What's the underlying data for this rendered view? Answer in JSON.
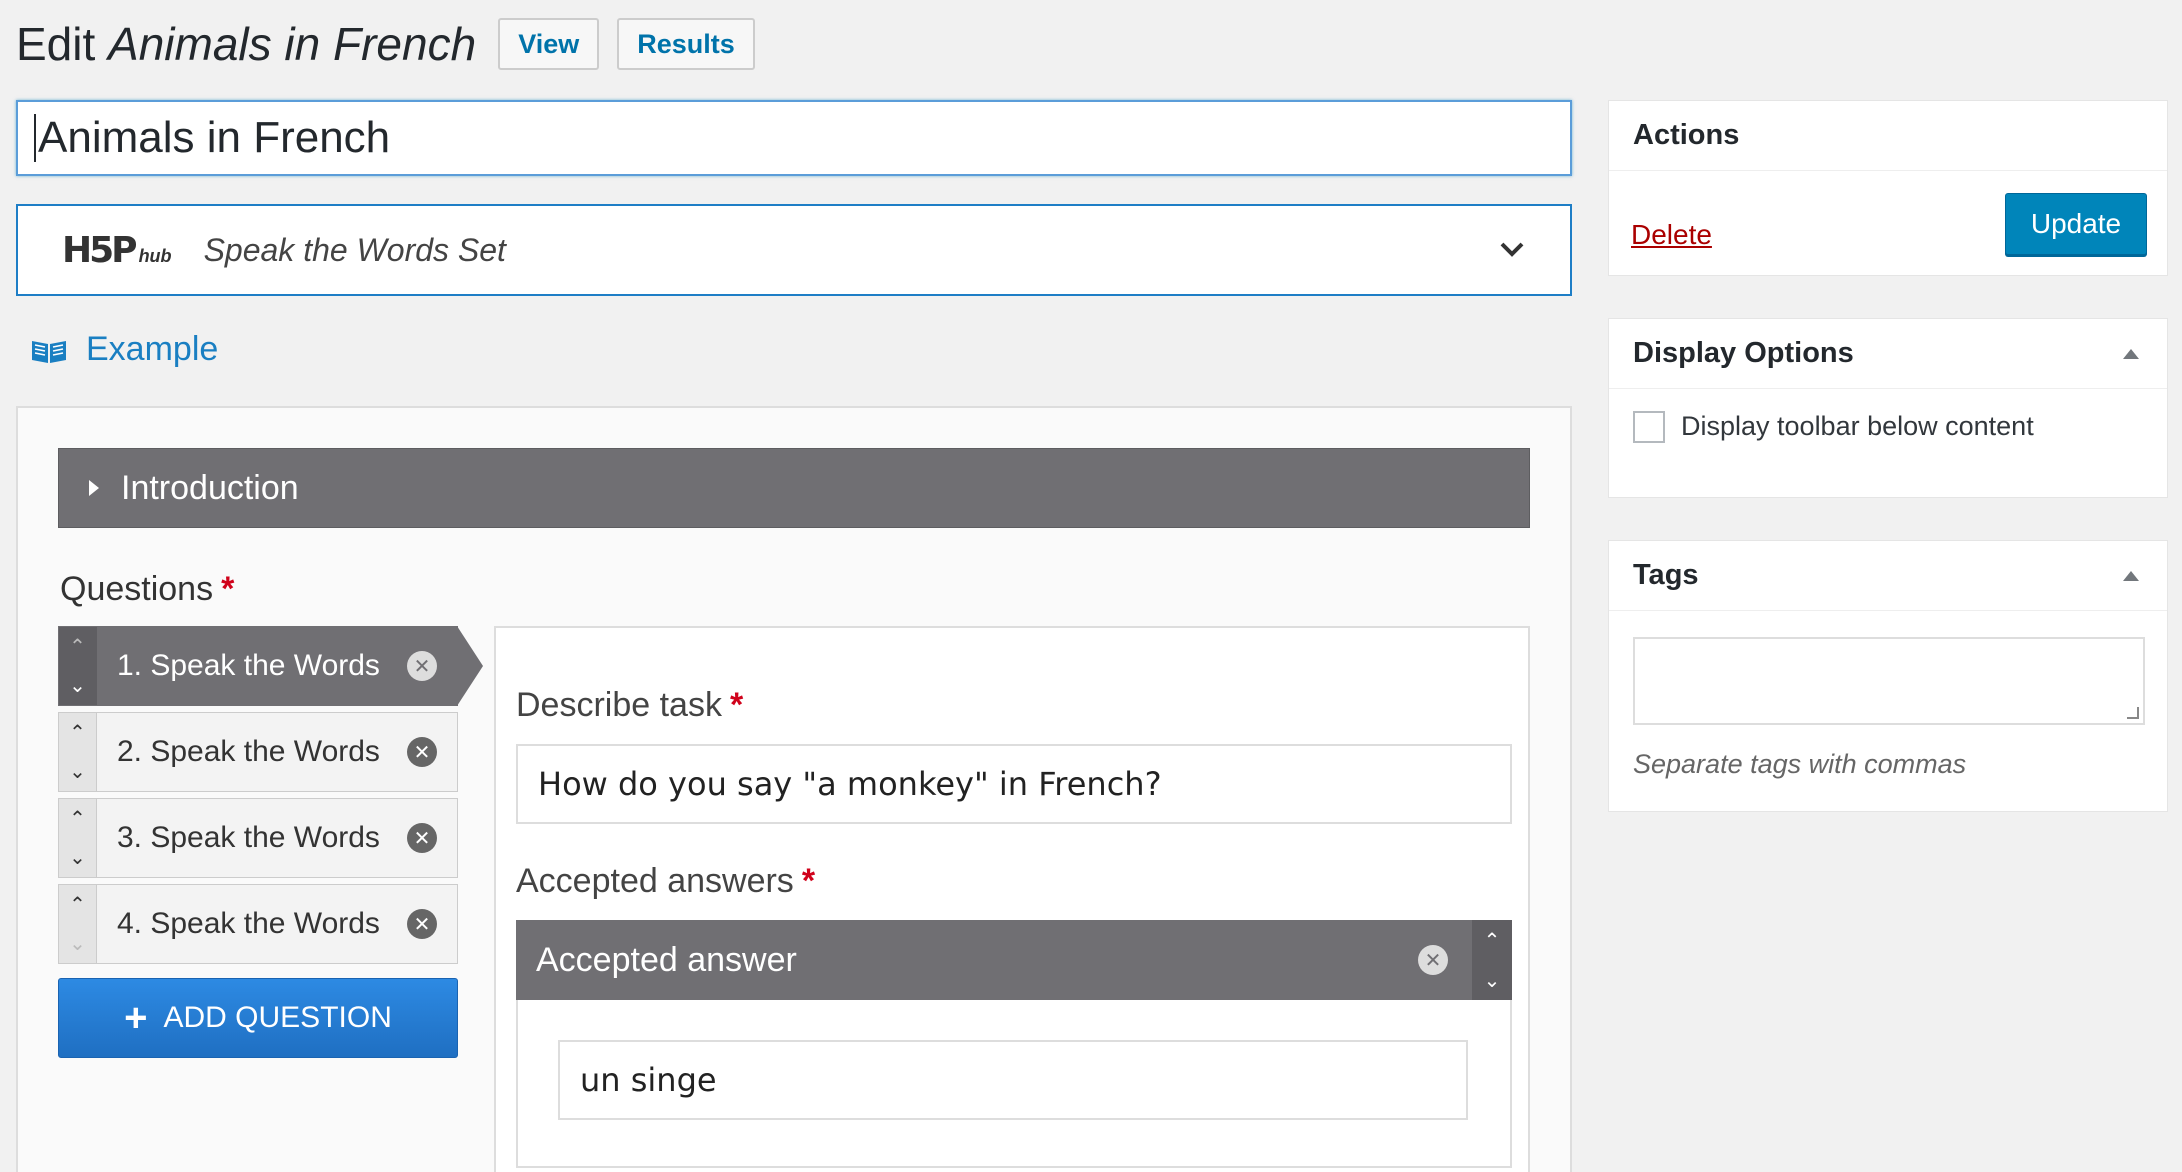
{
  "header": {
    "title_prefix": "Edit",
    "title_name": "Animals in French",
    "view_label": "View",
    "results_label": "Results"
  },
  "title_input": {
    "value": "Animals in French"
  },
  "hub": {
    "logo_text": "H5P",
    "logo_sub": "hub",
    "content_type": "Speak the Words Set"
  },
  "example": {
    "label": "Example"
  },
  "editor": {
    "introduction_label": "Introduction",
    "questions_label": "Questions",
    "required_mark": "*",
    "questions": [
      {
        "label": "1. Speak the Words"
      },
      {
        "label": "2. Speak the Words"
      },
      {
        "label": "3. Speak the Words"
      },
      {
        "label": "4. Speak the Words"
      }
    ],
    "add_question_label": "ADD QUESTION",
    "describe_task_label": "Describe task",
    "describe_task_value": "How do you say \"a monkey\" in French?",
    "accepted_answers_label": "Accepted answers",
    "accepted_answer_label": "Accepted answer",
    "accepted_answer_value": "un singe"
  },
  "sidebar": {
    "actions": {
      "title": "Actions",
      "delete_label": "Delete",
      "update_label": "Update"
    },
    "display_options": {
      "title": "Display Options",
      "checkbox_label": "Display toolbar below content"
    },
    "tags": {
      "title": "Tags",
      "hint": "Separate tags with commas"
    }
  },
  "colors": {
    "accent": "#0085ba",
    "link": "#0073aa",
    "h5p_blue": "#1f6fc2",
    "delete_red": "#a00",
    "required_red": "#d0021b"
  }
}
